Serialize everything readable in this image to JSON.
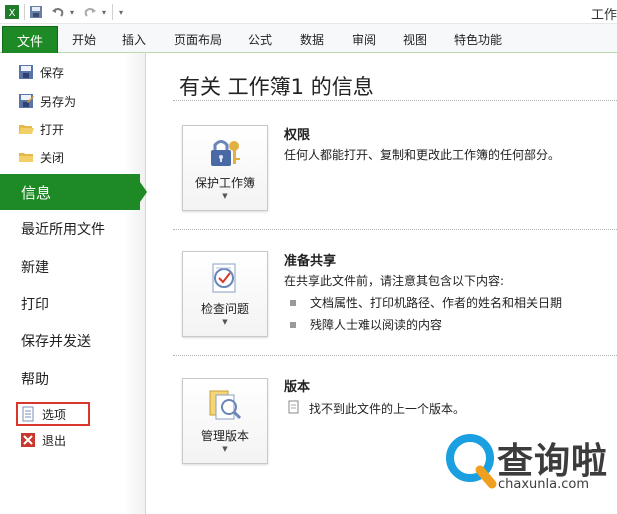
{
  "window": {
    "title": "工作"
  },
  "quick_access": {
    "icons": [
      "excel-app-icon",
      "save-icon",
      "undo-icon",
      "redo-icon",
      "customize-icon"
    ]
  },
  "ribbon": {
    "file_tab": "文件",
    "tabs": [
      "开始",
      "插入",
      "页面布局",
      "公式",
      "数据",
      "审阅",
      "视图",
      "特色功能"
    ]
  },
  "left_nav": {
    "small_top": [
      "保存",
      "另存为",
      "打开",
      "关闭"
    ],
    "info": "信息",
    "big_items": [
      "最近所用文件",
      "新建",
      "打印",
      "保存并发送",
      "帮助"
    ],
    "small_bottom": [
      "选项",
      "退出"
    ]
  },
  "main": {
    "title": "有关 工作簿1 的信息",
    "permissions": {
      "button": "保护工作簿",
      "title": "权限",
      "text": "任何人都能打开、复制和更改此工作簿的任何部分。"
    },
    "prepare": {
      "button": "检查问题",
      "title": "准备共享",
      "text": "在共享此文件前，请注意其包含以下内容:",
      "bullets": [
        "文档属性、打印机路径、作者的姓名和相关日期",
        "残障人士难以阅读的内容"
      ]
    },
    "versions": {
      "button": "管理版本",
      "title": "版本",
      "text": "找不到此文件的上一个版本。"
    }
  },
  "watermark": {
    "brand": "查询啦",
    "url": "chaxunla.com"
  },
  "colors": {
    "accent": "#1e8a25",
    "highlight": "#d9372c"
  }
}
